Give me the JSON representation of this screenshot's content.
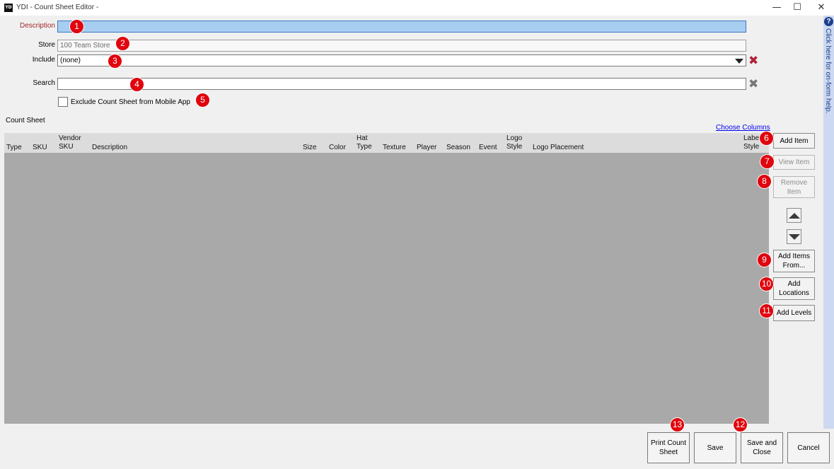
{
  "window": {
    "logo": "YD",
    "title": "YDI - Count Sheet Editor -",
    "minimize_glyph": "—",
    "maximize_glyph": "☐",
    "close_glyph": "✕"
  },
  "help": {
    "icon_glyph": "?",
    "text": "Click here for on-form help."
  },
  "form": {
    "description_label": "Description",
    "description_value": "",
    "store_label": "Store",
    "store_value": "100 Team Store",
    "include_label": "Include",
    "include_value": "(none)",
    "search_label": "Search",
    "search_value": "",
    "exclude_label": "Exclude Count Sheet from Mobile App",
    "exclude_checked": false,
    "clear_glyph": "✖"
  },
  "count_sheet": {
    "title": "Count Sheet",
    "choose_columns": "Choose Columns",
    "columns": [
      "Type",
      "SKU",
      "Vendor SKU",
      "Description",
      "Size",
      "Color",
      "Hat Type",
      "Texture",
      "Player",
      "Season",
      "Event",
      "Logo Style",
      "Logo Placement",
      "Label Style"
    ],
    "rows": []
  },
  "side_buttons": {
    "add_item": "Add Item",
    "view_item": "View Item",
    "remove_item": "Remove Item",
    "add_items_from": "Add Items From...",
    "add_locations": "Add Locations",
    "add_levels": "Add Levels"
  },
  "bottom_buttons": {
    "print": "Print Count Sheet",
    "save": "Save",
    "save_close": "Save and Close",
    "cancel": "Cancel"
  },
  "badges": [
    "1",
    "2",
    "3",
    "4",
    "5",
    "6",
    "7",
    "8",
    "9",
    "10",
    "11",
    "12",
    "13"
  ],
  "colors": {
    "badge": "#e0050e",
    "description_highlight": "#a7cdf0",
    "grid_body": "#a9a9a9",
    "include_clear": "#b0233a",
    "search_clear": "#777777",
    "help_strip": "#cdd9f0"
  }
}
